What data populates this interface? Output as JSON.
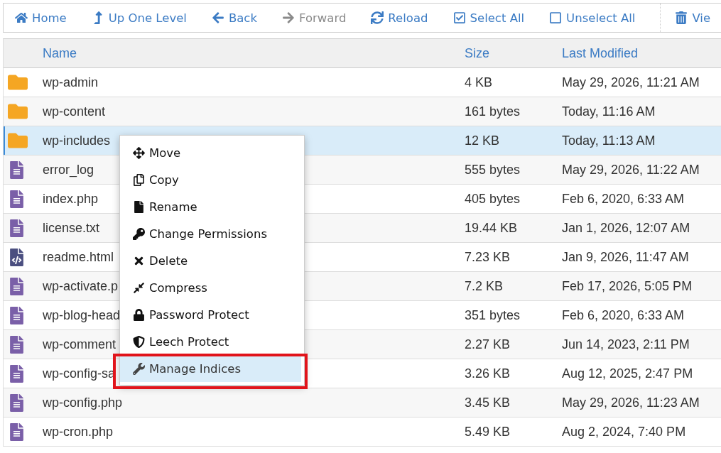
{
  "toolbar": [
    {
      "kind": "home",
      "label": "Home",
      "disabled": false
    },
    {
      "kind": "up",
      "label": "Up One Level",
      "disabled": false
    },
    {
      "kind": "back",
      "label": "Back",
      "disabled": false
    },
    {
      "kind": "forward",
      "label": "Forward",
      "disabled": true
    },
    {
      "kind": "reload",
      "label": "Reload",
      "disabled": false
    },
    {
      "kind": "select",
      "label": "Select All",
      "disabled": false
    },
    {
      "kind": "unselect",
      "label": "Unselect All",
      "disabled": false
    },
    {
      "kind": "trash",
      "label": "Vie",
      "disabled": false
    }
  ],
  "table": {
    "columns": [
      "Name",
      "Size",
      "Last Modified"
    ],
    "rows": [
      {
        "kind": "folder",
        "name": "wp-admin",
        "size": "4 KB",
        "modified": "May 29, 2026, 11:21 AM",
        "selected": false
      },
      {
        "kind": "folder",
        "name": "wp-content",
        "size": "161 bytes",
        "modified": "Today, 11:16 AM",
        "selected": false
      },
      {
        "kind": "folder",
        "name": "wp-includes",
        "size": "12 KB",
        "modified": "Today, 11:13 AM",
        "selected": true
      },
      {
        "kind": "file",
        "name": "error_log",
        "size": "555 bytes",
        "modified": "May 29, 2026, 11:22 AM",
        "selected": false
      },
      {
        "kind": "file",
        "name": "index.php",
        "size": "405 bytes",
        "modified": "Feb 6, 2020, 6:33 AM",
        "selected": false
      },
      {
        "kind": "file",
        "name": "license.txt",
        "size": "19.44 KB",
        "modified": "Jan 1, 2026, 12:07 AM",
        "selected": false
      },
      {
        "kind": "code",
        "name": "readme.html",
        "size": "7.23 KB",
        "modified": "Jan 9, 2026, 11:47 AM",
        "selected": false
      },
      {
        "kind": "file",
        "name": "wp-activate.p",
        "size": "7.2 KB",
        "modified": "Feb 17, 2026, 5:05 PM",
        "selected": false
      },
      {
        "kind": "file",
        "name": "wp-blog-head",
        "size": "351 bytes",
        "modified": "Feb 6, 2020, 6:33 AM",
        "selected": false
      },
      {
        "kind": "file",
        "name": "wp-comment",
        "size": "2.27 KB",
        "modified": "Jun 14, 2023, 2:11 PM",
        "selected": false
      },
      {
        "kind": "file",
        "name": "wp-config-sa",
        "size": "3.26 KB",
        "modified": "Aug 12, 2025, 2:47 PM",
        "selected": false
      },
      {
        "kind": "file",
        "name": "wp-config.php",
        "size": "3.45 KB",
        "modified": "May 29, 2026, 11:23 AM",
        "selected": false
      },
      {
        "kind": "file",
        "name": "wp-cron.php",
        "size": "5.49 KB",
        "modified": "Aug 2, 2024, 7:40 PM",
        "selected": false
      }
    ]
  },
  "context_menu": {
    "items": [
      {
        "kind": "move",
        "label": "Move",
        "selected": false
      },
      {
        "kind": "copy",
        "label": "Copy",
        "selected": false
      },
      {
        "kind": "rename",
        "label": "Rename",
        "selected": false
      },
      {
        "kind": "permissions",
        "label": "Change Permissions",
        "selected": false
      },
      {
        "kind": "delete",
        "label": "Delete",
        "selected": false
      },
      {
        "kind": "compress",
        "label": "Compress",
        "selected": false
      },
      {
        "kind": "password",
        "label": "Password Protect",
        "selected": false
      },
      {
        "kind": "leech",
        "label": "Leech Protect",
        "selected": false
      },
      {
        "kind": "indices",
        "label": "Manage Indices",
        "selected": true
      }
    ]
  }
}
